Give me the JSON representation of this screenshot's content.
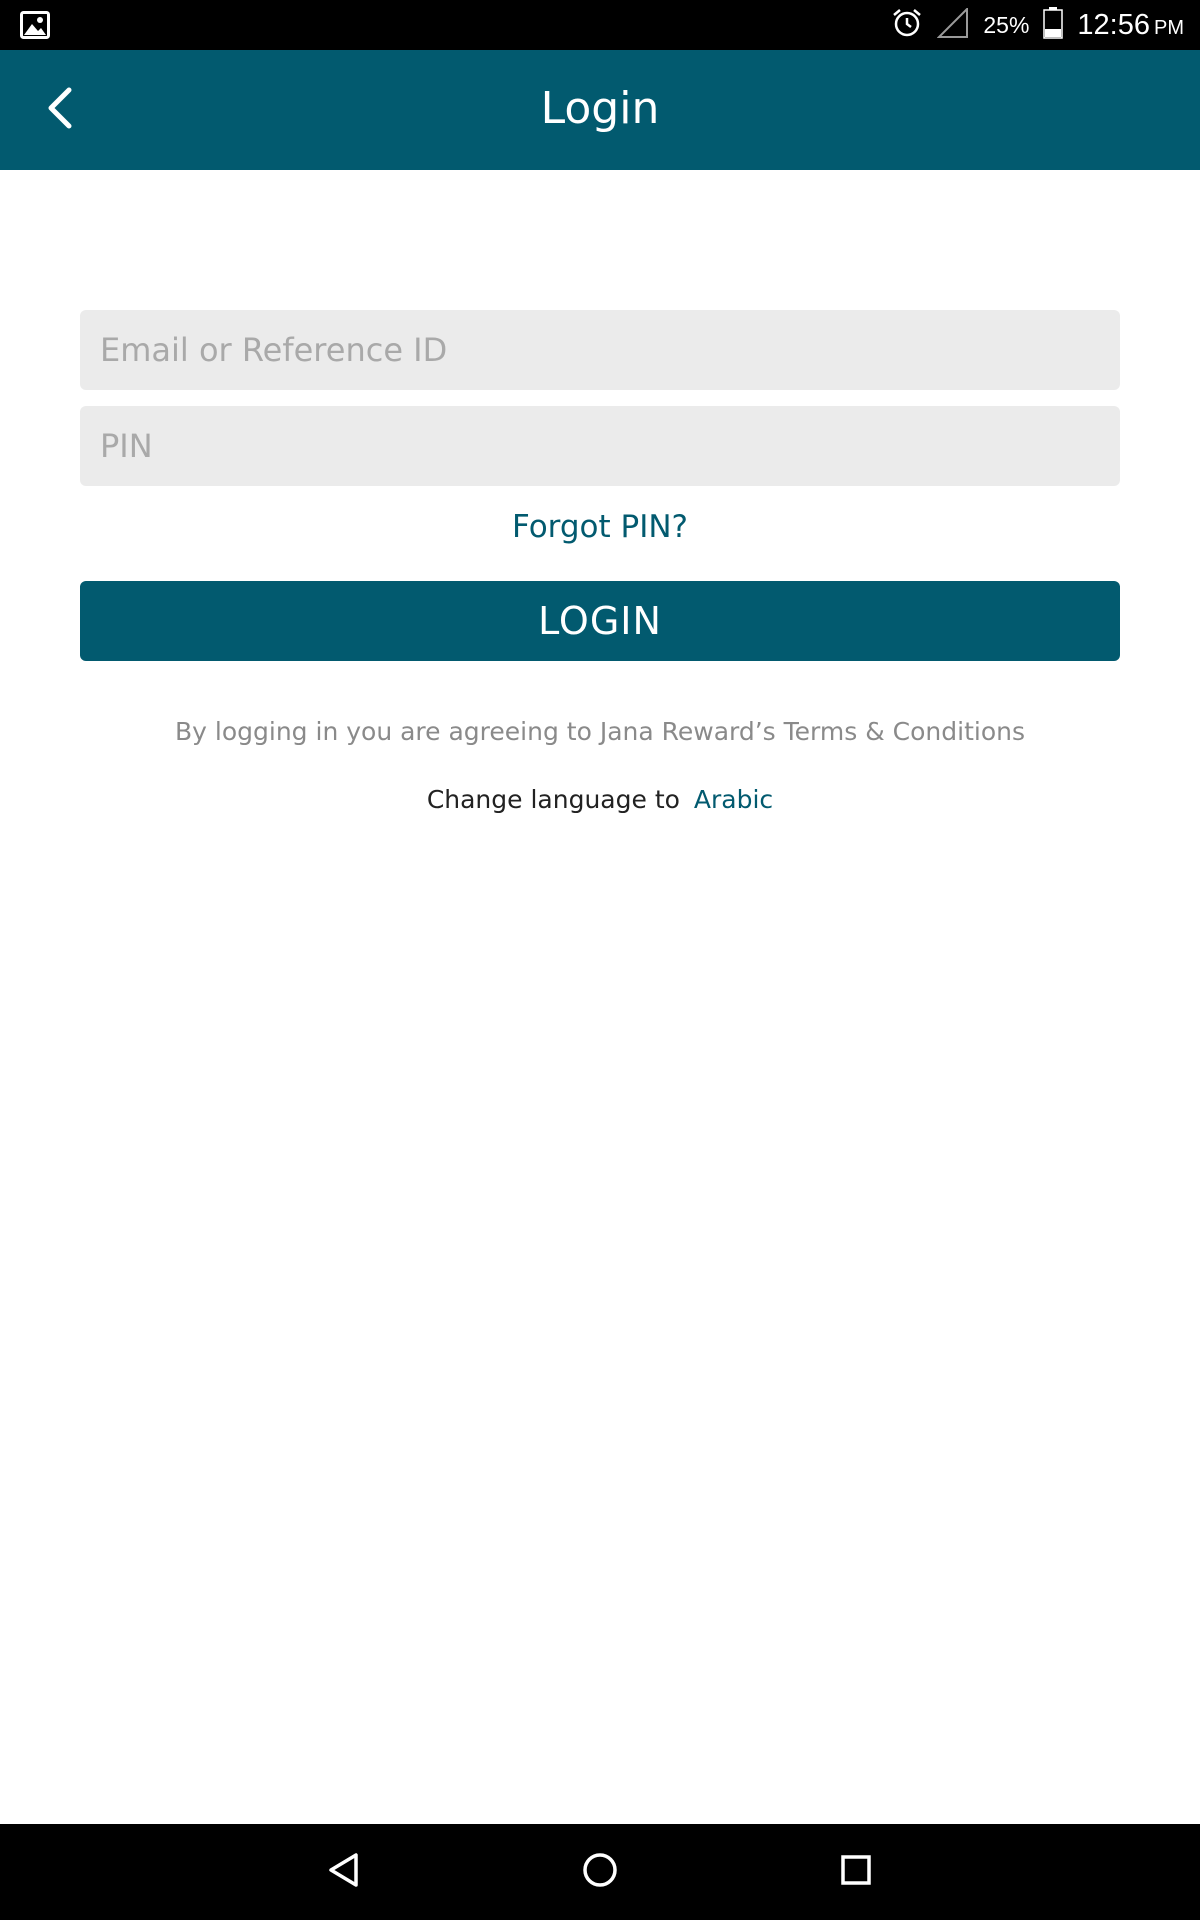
{
  "status_bar": {
    "battery_percent": "25%",
    "time": "12:56",
    "ampm": "PM",
    "icons": [
      "gallery-icon",
      "alarm-icon",
      "signal-icon",
      "battery-icon"
    ]
  },
  "app_bar": {
    "title": "Login",
    "back_icon": "chevron-left-icon",
    "background_color": "#025a6f"
  },
  "form": {
    "email_placeholder": "Email or Reference ID",
    "email_value": "",
    "pin_placeholder": "PIN",
    "pin_value": "",
    "forgot_label": "Forgot PIN?",
    "login_label": "LOGIN"
  },
  "terms_text": "By logging in you are agreeing to Jana Reward’s Terms & Conditions",
  "language": {
    "label": "Change language to",
    "link": "Arabic"
  },
  "nav_bar": {
    "icons": [
      "back-triangle-icon",
      "home-circle-icon",
      "recents-square-icon"
    ]
  },
  "colors": {
    "accent": "#025a6f",
    "input_bg": "#ebebeb",
    "placeholder": "#a9a9a9",
    "muted_text": "#8a8a8a"
  }
}
